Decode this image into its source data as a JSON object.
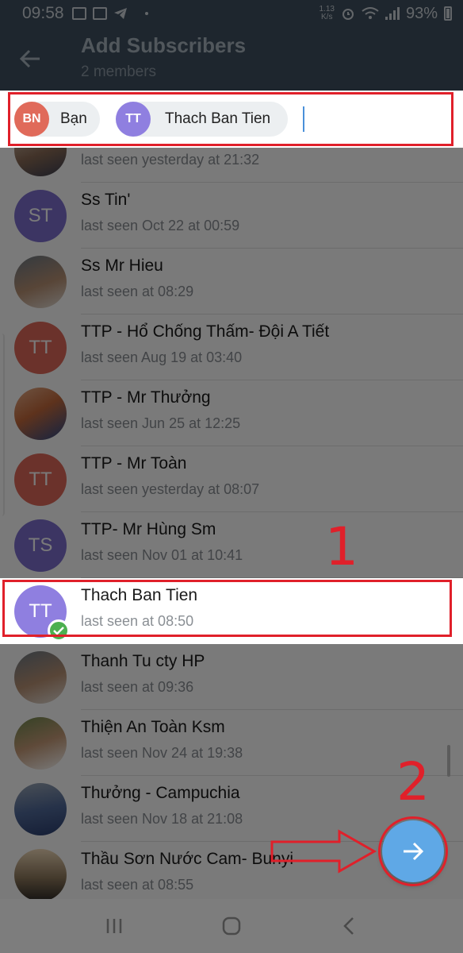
{
  "statusbar": {
    "time": "09:58",
    "net_speed": "1.13\nK/s",
    "battery": "93%"
  },
  "header": {
    "title": "Add Subscribers",
    "subtitle": "2 members",
    "back_icon": "arrow-left-icon"
  },
  "selected": [
    {
      "initials": "BN",
      "label": "Bạn",
      "color": "#e06a5a"
    },
    {
      "initials": "TT",
      "label": "Thach Ban Tien",
      "color": "#8f7fe0"
    }
  ],
  "contacts": [
    {
      "name": "",
      "status": "last seen yesterday at 21:32",
      "avatar": "photo"
    },
    {
      "name": "Ss Tin'",
      "status": "last seen Oct 22 at 00:59",
      "initials": "ST",
      "color": "#7d6fd0"
    },
    {
      "name": "Ss Mr Hieu",
      "status": "last seen at 08:29",
      "avatar": "photo"
    },
    {
      "name": "TTP - Hổ Chống Thấm- Đội A Tiết",
      "status": "last seen Aug 19 at 03:40",
      "initials": "TT",
      "color": "#e06a5a"
    },
    {
      "name": "TTP - Mr Thưởng",
      "status": "last seen Jun 25 at 12:25",
      "avatar": "photo"
    },
    {
      "name": "TTP - Mr Toàn",
      "status": "last seen yesterday at 08:07",
      "initials": "TT",
      "color": "#e06a5a"
    },
    {
      "name": "TTP- Mr Hùng Sm",
      "status": "last seen Nov 01 at 10:41",
      "initials": "TS",
      "color": "#7d6fd0"
    },
    {
      "name": "Thach Ban Tien",
      "status": "last seen at 08:50",
      "initials": "TT",
      "color": "#8f7fe0",
      "selected": true
    },
    {
      "name": "Thanh Tu cty HP",
      "status": "last seen at 09:36",
      "avatar": "photo"
    },
    {
      "name": "Thiện An Toàn Ksm",
      "status": "last seen Nov 24 at 19:38",
      "avatar": "photo"
    },
    {
      "name": "Thưởng - Campuchia",
      "status": "last seen Nov 18 at 21:08",
      "avatar": "photo"
    },
    {
      "name": "Thầu Sơn Nước Cam- Bunyi",
      "status": "last seen at 08:55",
      "avatar": "photo"
    }
  ],
  "annotations": {
    "step1": "1",
    "step2": "2"
  },
  "fab": {
    "icon": "arrow-right-icon"
  },
  "colors": {
    "header_bg": "#3f5161",
    "highlight_border": "#e0202a",
    "check_green": "#4cb050",
    "fab_blue": "#5fa8e6"
  }
}
